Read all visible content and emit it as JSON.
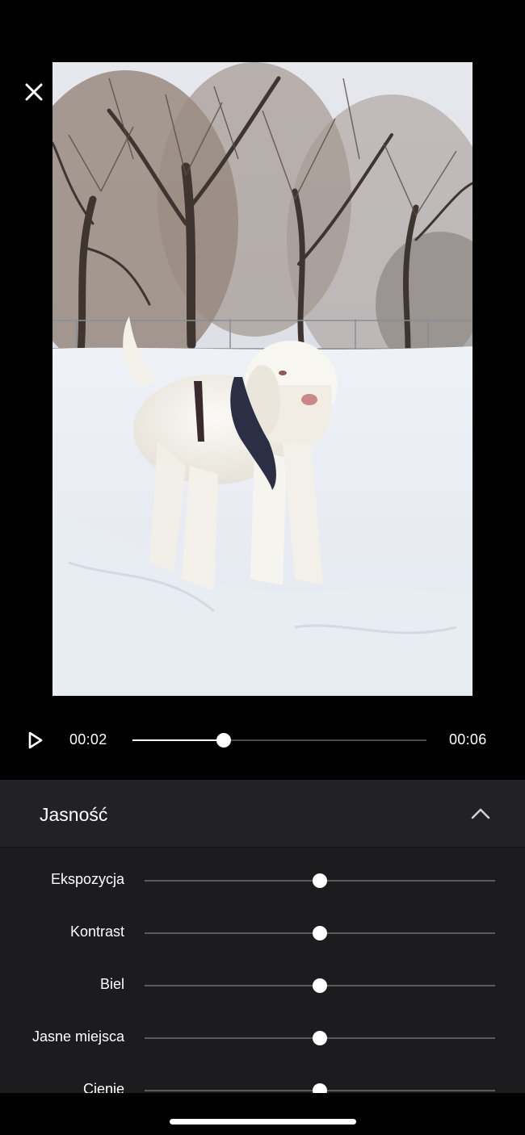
{
  "player": {
    "current_time": "00:02",
    "total_time": "00:06",
    "progress": 0.31
  },
  "panel": {
    "title": "Jasność",
    "sliders": [
      {
        "label": "Ekspozycja",
        "value": 0.5
      },
      {
        "label": "Kontrast",
        "value": 0.5
      },
      {
        "label": "Biel",
        "value": 0.5
      },
      {
        "label": "Jasne miejsca",
        "value": 0.5
      },
      {
        "label": "Cienie",
        "value": 0.5
      }
    ]
  },
  "icons": {
    "close": "close-icon",
    "play": "play-icon",
    "collapse": "chevron-up-icon"
  }
}
